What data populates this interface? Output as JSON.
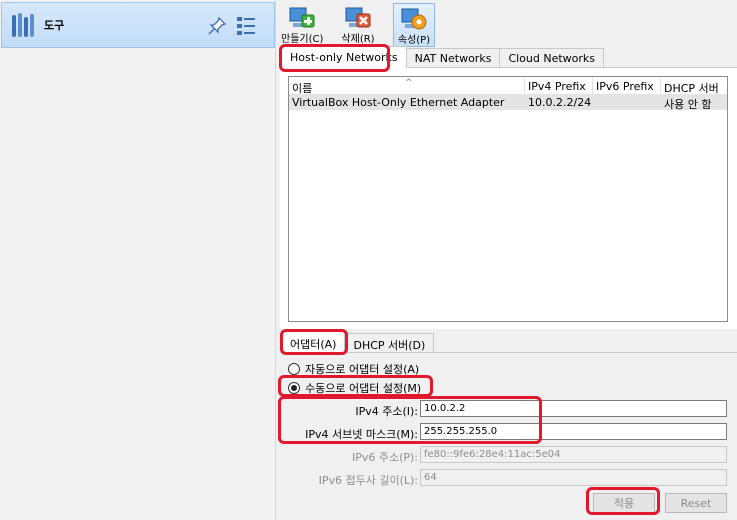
{
  "sidebar": {
    "tools_label": "도구"
  },
  "toolbar": {
    "create_label": "만들기(C)",
    "remove_label": "삭제(R)",
    "properties_label": "속성(P)"
  },
  "main_tabs": {
    "host_only": "Host-only Networks",
    "nat": "NAT Networks",
    "cloud": "Cloud Networks"
  },
  "table": {
    "columns": [
      "이름",
      "IPv4 Prefix",
      "IPv6 Prefix",
      "DHCP 서버"
    ],
    "rows": [
      {
        "name": "VirtualBox Host-Only Ethernet Adapter",
        "ipv4": "10.0.2.2/24",
        "ipv6": "",
        "dhcp": "사용 안 함"
      }
    ]
  },
  "bottom_tabs": {
    "adapter": "어댑터(A)",
    "dhcp": "DHCP 서버(D)"
  },
  "adapter": {
    "auto_label": "자동으로 어댑터 설정(A)",
    "manual_label": "수동으로 어댑터 설정(M)",
    "ipv4_addr_label": "IPv4 주소(I):",
    "ipv4_addr_value": "10.0.2.2",
    "ipv4_mask_label": "IPv4 서브넷 마스크(M):",
    "ipv4_mask_value": "255.255.255.0",
    "ipv6_addr_label": "IPv6 주소(P):",
    "ipv6_addr_value": "fe80::9fe6:28e4:11ac:5e04",
    "ipv6_prefix_label": "IPv6 접두사 길이(L):",
    "ipv6_prefix_value": "64",
    "apply_label": "적용",
    "reset_label": "Reset"
  },
  "colors": {
    "highlight": "#e0192d",
    "selection_bg": "#c7def7"
  }
}
